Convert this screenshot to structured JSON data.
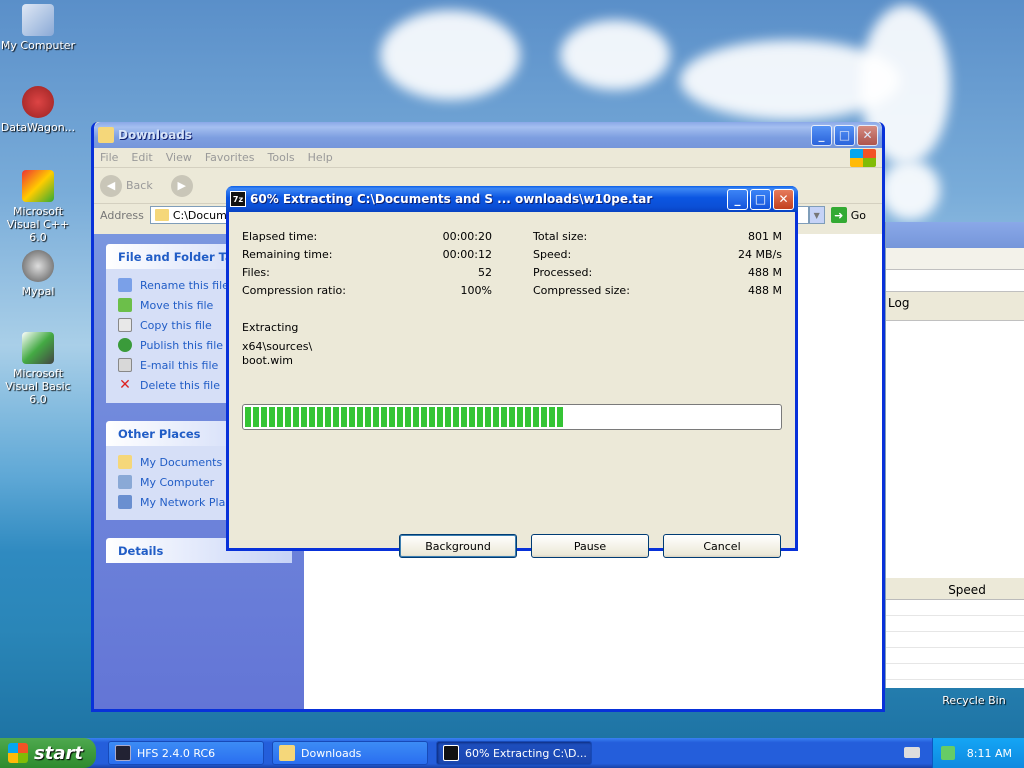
{
  "desktop": {
    "icons": [
      {
        "label": "My Computer",
        "icon": "my-computer-icon"
      },
      {
        "label": "DataWagon...",
        "icon": "datawagon-icon"
      },
      {
        "label": "Microsoft Visual C++ 6.0",
        "icon": "visual-cpp-icon"
      },
      {
        "label": "Mypal",
        "icon": "mypal-icon"
      },
      {
        "label": "Microsoft Visual Basic 6.0",
        "icon": "visual-basic-icon"
      }
    ],
    "recycle_bin": "Recycle Bin"
  },
  "explorer": {
    "title": "Downloads",
    "menu": [
      "File",
      "Edit",
      "View",
      "Favorites",
      "Tools",
      "Help"
    ],
    "toolbar": {
      "back": "Back"
    },
    "address_label": "Address",
    "address_value": "C:\\Documents",
    "go_label": "Go",
    "file_tasks": {
      "title": "File and Folder Tasks",
      "items": [
        "Rename this file",
        "Move this file",
        "Copy this file",
        "Publish this file to",
        "E-mail this file",
        "Delete this file"
      ]
    },
    "other_places": {
      "title": "Other Places",
      "items": [
        "My Documents",
        "My Computer",
        "My Network Places"
      ]
    },
    "details": {
      "title": "Details"
    }
  },
  "background_window": {
    "log_label": "Log",
    "speed_col": "Speed"
  },
  "dialog": {
    "title": "60% Extracting C:\\Documents and S ... ownloads\\w10pe.tar",
    "stats_left": [
      {
        "label": "Elapsed time:",
        "value": "00:00:20"
      },
      {
        "label": "Remaining time:",
        "value": "00:00:12"
      },
      {
        "label": "Files:",
        "value": "52"
      },
      {
        "label": "Compression ratio:",
        "value": "100%"
      }
    ],
    "stats_right": [
      {
        "label": "Total size:",
        "value": "801 M"
      },
      {
        "label": "Speed:",
        "value": "24 MB/s"
      },
      {
        "label": "Processed:",
        "value": "488 M"
      },
      {
        "label": "Compressed size:",
        "value": "488 M"
      }
    ],
    "status_label": "Extracting",
    "path": "x64\\sources\\",
    "file": "boot.wim",
    "progress_fraction": 0.6,
    "buttons": {
      "background": "Background",
      "pause": "Pause",
      "cancel": "Cancel"
    }
  },
  "taskbar": {
    "start_label": "start",
    "tasks": [
      {
        "label": "HFS 2.4.0 RC6",
        "icon": "hfs-icon"
      },
      {
        "label": "Downloads",
        "icon": "folder-icon"
      },
      {
        "label": "60% Extracting C:\\D...",
        "icon": "7zip-icon"
      }
    ],
    "clock": "8:11 AM"
  }
}
